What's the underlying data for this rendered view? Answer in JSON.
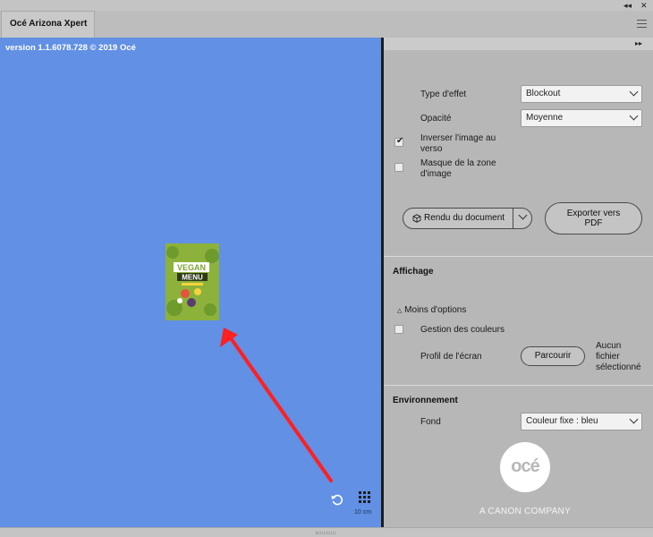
{
  "window": {
    "tab_title": "Océ Arizona Xpert",
    "collapse_glyph": "◂◂",
    "close_glyph": "✕",
    "menu_icon": "hamburger-icon"
  },
  "preview": {
    "version": "version 1.1.6078.728 © 2019 Océ",
    "background_color": "#6190e4",
    "thumbnail": {
      "line1": "VEGAN",
      "line2": "MENU"
    },
    "scale_label": "10 cm",
    "annotation_color": "#ff2020"
  },
  "panel": {
    "expand_glyph": "▸▸",
    "effect_type": {
      "label": "Type d'effet",
      "value": "Blockout"
    },
    "opacity": {
      "label": "Opacité",
      "value": "Moyenne"
    },
    "invert_image": {
      "label_line1": "Inverser l'image au",
      "label_line2": "verso",
      "checked": true
    },
    "mask_image": {
      "label_line1": "Masque de la zone",
      "label_line2": "d'image",
      "checked": false
    },
    "render_button": "Rendu du document",
    "export_button_line1": "Exporter vers",
    "export_button_line2": "PDF"
  },
  "display": {
    "title": "Affichage",
    "less_options": "Moins d'options",
    "less_options_glyph": "△",
    "color_management": {
      "label": "Gestion des couleurs",
      "checked": false
    },
    "screen_profile_label": "Profil de l'écran",
    "browse_button": "Parcourir",
    "no_file_line1": "Aucun",
    "no_file_line2": "fichier",
    "no_file_line3": "sélectionné"
  },
  "environment": {
    "title": "Environnement",
    "background_label": "Fond",
    "background_value": "Couleur fixe : bleu"
  },
  "branding": {
    "logo_text": "océ",
    "tagline": "A CANON COMPANY"
  }
}
